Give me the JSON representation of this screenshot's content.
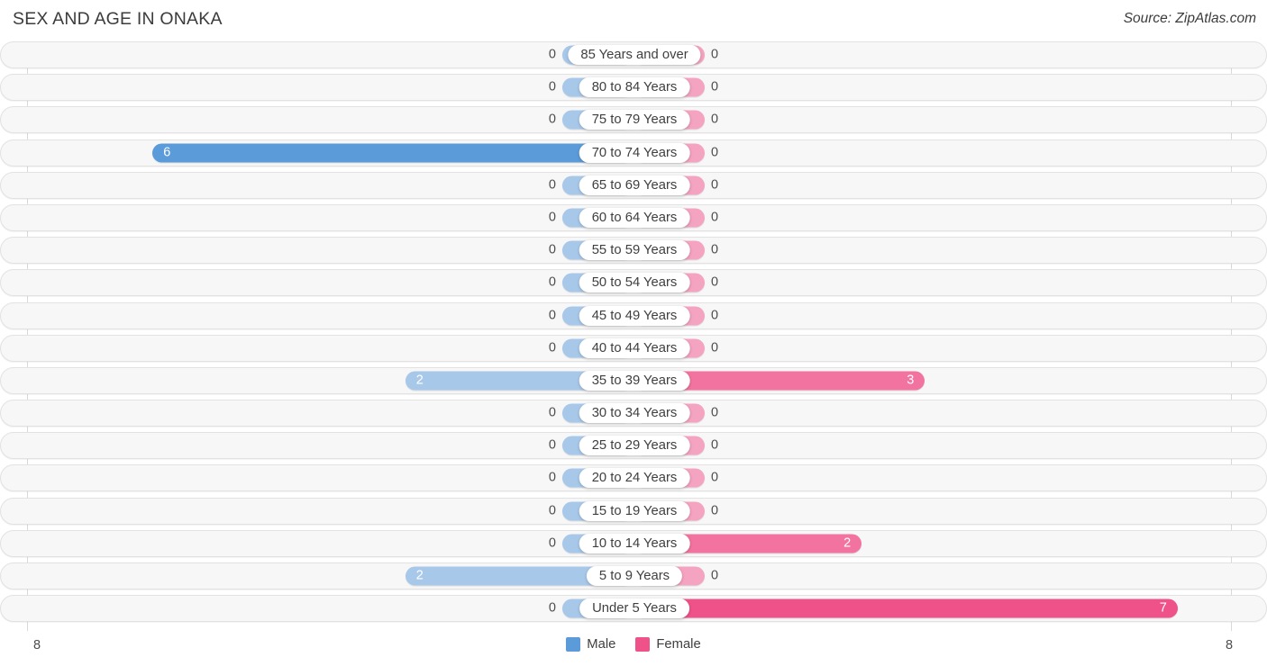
{
  "header": {
    "title": "SEX AND AGE IN ONAKA",
    "source": "Source: ZipAtlas.com"
  },
  "legend": {
    "male_label": "Male",
    "female_label": "Female",
    "male_color": "#5b9bd9",
    "female_color": "#ef5189"
  },
  "axis": {
    "left_tick": "8",
    "right_tick": "8",
    "max": 8
  },
  "chart_data": {
    "type": "bar",
    "subtype": "population-pyramid",
    "title": "SEX AND AGE IN ONAKA",
    "xlabel": "",
    "ylabel": "",
    "xlim": [
      8,
      8
    ],
    "grid": true,
    "legend_position": "bottom-center",
    "categories": [
      "85 Years and over",
      "80 to 84 Years",
      "75 to 79 Years",
      "70 to 74 Years",
      "65 to 69 Years",
      "60 to 64 Years",
      "55 to 59 Years",
      "50 to 54 Years",
      "45 to 49 Years",
      "40 to 44 Years",
      "35 to 39 Years",
      "30 to 34 Years",
      "25 to 29 Years",
      "20 to 24 Years",
      "15 to 19 Years",
      "10 to 14 Years",
      "5 to 9 Years",
      "Under 5 Years"
    ],
    "series": [
      {
        "name": "Male",
        "values": [
          0,
          0,
          0,
          6,
          0,
          0,
          0,
          0,
          0,
          0,
          2,
          0,
          0,
          0,
          0,
          0,
          2,
          0
        ]
      },
      {
        "name": "Female",
        "values": [
          0,
          0,
          0,
          0,
          0,
          0,
          0,
          0,
          0,
          0,
          3,
          0,
          0,
          0,
          0,
          2,
          0,
          7
        ]
      }
    ]
  },
  "rows": [
    {
      "label": "85 Years and over",
      "male": "0",
      "female": "0",
      "male_val": 0,
      "female_val": 0
    },
    {
      "label": "80 to 84 Years",
      "male": "0",
      "female": "0",
      "male_val": 0,
      "female_val": 0
    },
    {
      "label": "75 to 79 Years",
      "male": "0",
      "female": "0",
      "male_val": 0,
      "female_val": 0
    },
    {
      "label": "70 to 74 Years",
      "male": "6",
      "female": "0",
      "male_val": 6,
      "female_val": 0
    },
    {
      "label": "65 to 69 Years",
      "male": "0",
      "female": "0",
      "male_val": 0,
      "female_val": 0
    },
    {
      "label": "60 to 64 Years",
      "male": "0",
      "female": "0",
      "male_val": 0,
      "female_val": 0
    },
    {
      "label": "55 to 59 Years",
      "male": "0",
      "female": "0",
      "male_val": 0,
      "female_val": 0
    },
    {
      "label": "50 to 54 Years",
      "male": "0",
      "female": "0",
      "male_val": 0,
      "female_val": 0
    },
    {
      "label": "45 to 49 Years",
      "male": "0",
      "female": "0",
      "male_val": 0,
      "female_val": 0
    },
    {
      "label": "40 to 44 Years",
      "male": "0",
      "female": "0",
      "male_val": 0,
      "female_val": 0
    },
    {
      "label": "35 to 39 Years",
      "male": "2",
      "female": "3",
      "male_val": 2,
      "female_val": 3
    },
    {
      "label": "30 to 34 Years",
      "male": "0",
      "female": "0",
      "male_val": 0,
      "female_val": 0
    },
    {
      "label": "25 to 29 Years",
      "male": "0",
      "female": "0",
      "male_val": 0,
      "female_val": 0
    },
    {
      "label": "20 to 24 Years",
      "male": "0",
      "female": "0",
      "male_val": 0,
      "female_val": 0
    },
    {
      "label": "15 to 19 Years",
      "male": "0",
      "female": "0",
      "male_val": 0,
      "female_val": 0
    },
    {
      "label": "10 to 14 Years",
      "male": "0",
      "female": "2",
      "male_val": 0,
      "female_val": 2
    },
    {
      "label": "5 to 9 Years",
      "male": "2",
      "female": "0",
      "male_val": 2,
      "female_val": 0
    },
    {
      "label": "Under 5 Years",
      "male": "0",
      "female": "7",
      "male_val": 0,
      "female_val": 7
    }
  ]
}
